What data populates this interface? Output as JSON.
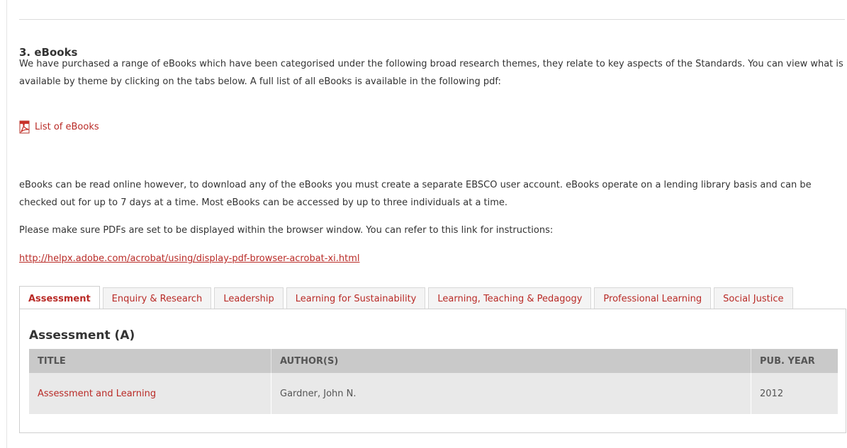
{
  "section": {
    "heading": "3. eBooks",
    "intro": "We have purchased a range of eBooks which have been categorised under the following broad research themes, they relate to key aspects of the Standards. You can view what is available by theme by clicking on the tabs below. A full list of all eBooks is available in the following pdf:",
    "pdf_link": {
      "label": "List of eBooks",
      "icon": "pdf-icon"
    },
    "lending_text": "eBooks can be read online however, to download any of the eBooks you must create a separate EBSCO user account. eBooks operate on a lending library basis and can be checked out for up to 7 days at a time. Most eBooks can be accessed by up to three individuals at a time.",
    "pdf_settings_text": "Please make sure PDFs are set to be displayed within the browser window. You can refer to this link for instructions:",
    "help_url": "http://helpx.adobe.com/acrobat/using/display-pdf-browser-acrobat-xi.html"
  },
  "tabs": [
    {
      "label": "Assessment",
      "active": true
    },
    {
      "label": "Enquiry & Research"
    },
    {
      "label": "Leadership"
    },
    {
      "label": "Learning for Sustainability"
    },
    {
      "label": "Learning, Teaching & Pedagogy"
    },
    {
      "label": "Professional Learning"
    },
    {
      "label": "Social Justice"
    }
  ],
  "panel": {
    "title": "Assessment (A)",
    "columns": [
      "TITLE",
      "AUTHOR(S)",
      "PUB. YEAR"
    ],
    "rows": [
      {
        "title": "Assessment and Learning",
        "author": "Gardner, John N.",
        "year": "2012"
      }
    ]
  },
  "colors": {
    "link": "#b92b27",
    "header_bg": "#c9c9c9",
    "row_bg": "#e9e9e9"
  }
}
